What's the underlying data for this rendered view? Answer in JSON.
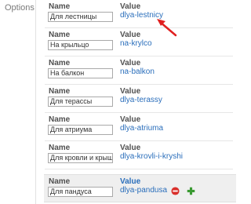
{
  "sidebar": {
    "section_label": "Options"
  },
  "column_labels": {
    "name": "Name",
    "value": "Value"
  },
  "rows": [
    {
      "name": "Для лестницы",
      "value": "dlya-lestnicy"
    },
    {
      "name": "На крыльцо",
      "value": "na-krylco"
    },
    {
      "name": "На балкон",
      "value": "na-balkon"
    },
    {
      "name": "Для терассы",
      "value": "dlya-terassy"
    },
    {
      "name": "Для атриума",
      "value": "dlya-atriuma"
    },
    {
      "name": "Для кровли и крыши",
      "value": "dlya-krovli-i-kryshi"
    },
    {
      "name": "Для пандуса",
      "value": "dlya-pandusa"
    }
  ],
  "icons": {
    "remove": "remove-icon",
    "add": "add-icon",
    "annotation": "red-arrow"
  },
  "colors": {
    "link": "#2a6ebb",
    "remove": "#d9302b",
    "add": "#3a9a32",
    "arrow": "#e02020"
  }
}
